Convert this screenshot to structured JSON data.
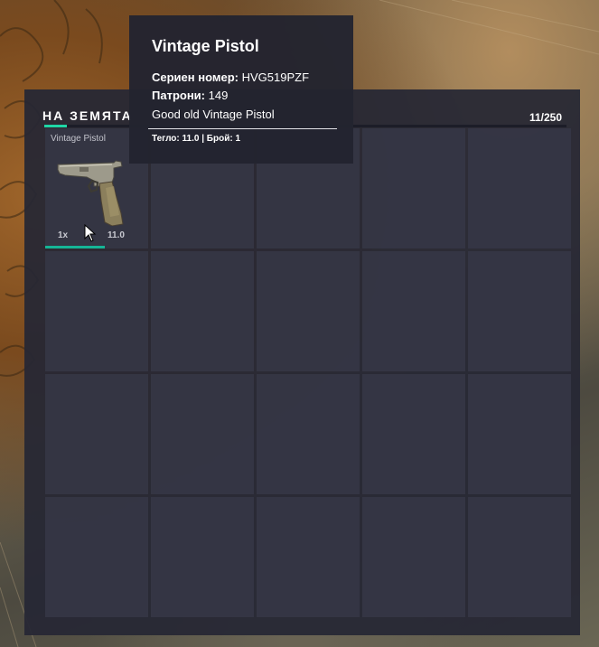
{
  "inventory": {
    "title": "НА ЗЕМЯТА",
    "capacity": "11/250",
    "accent_color": "#1fd6a6",
    "slots": [
      {
        "name": "Vintage Pistol",
        "quantity": "1x",
        "weight": "11.0",
        "durability_fraction": 0.58,
        "icon": "vintage-pistol-icon"
      }
    ]
  },
  "tooltip": {
    "title": "Vintage Pistol",
    "serial_label": "Сериен номер:",
    "serial_value": "HVG519PZF",
    "ammo_label": "Патрони:",
    "ammo_value": "149",
    "description": "Good old Vintage Pistol",
    "footer": "Тегло: 11.0 | Брой: 1"
  },
  "cursor": "arrow-cursor-icon"
}
